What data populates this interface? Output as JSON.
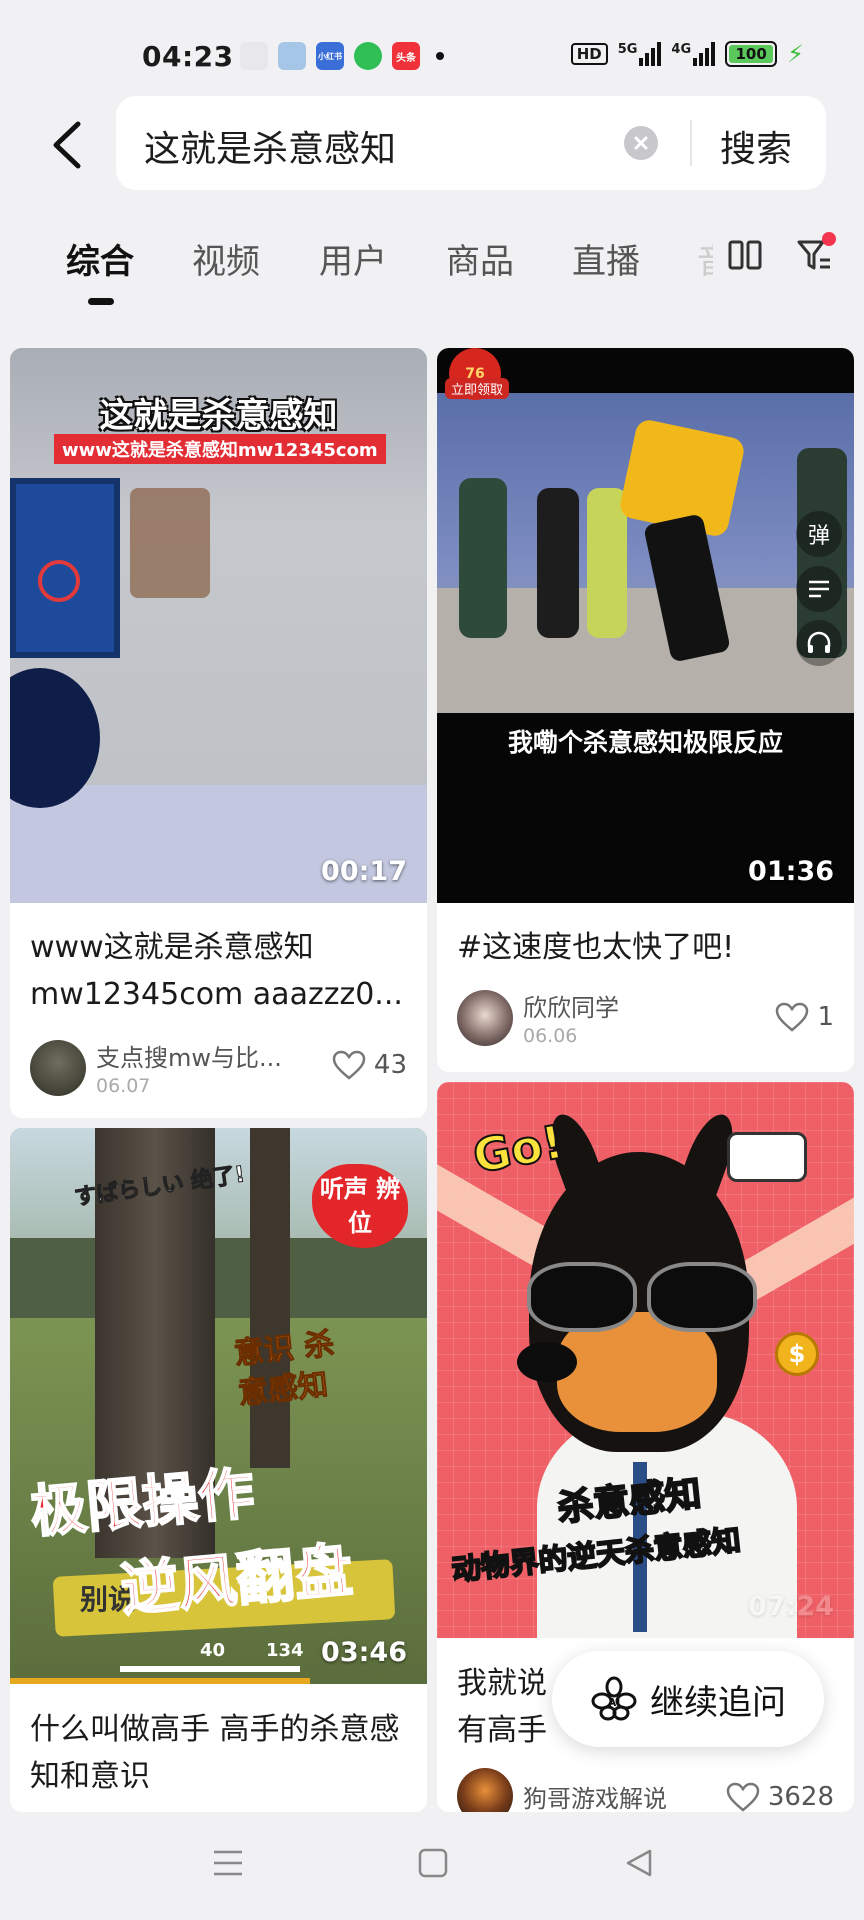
{
  "status_bar": {
    "time": "04:23",
    "app_icons": [
      {
        "name": "app-1-icon",
        "label": "",
        "color": "#e8e8ea"
      },
      {
        "name": "app-2-icon",
        "label": "",
        "color": "#a6c6e8"
      },
      {
        "name": "xiaohongshu-icon",
        "label": "小红书",
        "color": "#3a6fd8"
      },
      {
        "name": "app-4-icon",
        "label": "",
        "color": "#2fbf55"
      },
      {
        "name": "toutiao-icon",
        "label": "头条",
        "color": "#f0313a"
      }
    ],
    "hd_label": "HD",
    "net1": "5G",
    "net2": "4G",
    "battery": "100"
  },
  "search": {
    "query": "这就是杀意感知",
    "submit_label": "搜索"
  },
  "tabs": [
    {
      "label": "综合",
      "active": true
    },
    {
      "label": "视频",
      "active": false
    },
    {
      "label": "用户",
      "active": false
    },
    {
      "label": "商品",
      "active": false
    },
    {
      "label": "直播",
      "active": false
    },
    {
      "label": "音",
      "active": false
    }
  ],
  "cards": [
    {
      "duration": "00:17",
      "overlay_title": "这就是杀意感知",
      "overlay_sub": "www这就是杀意感知mw12345com",
      "title": "www这就是杀意感知 mw12345com aaazzz0...",
      "author": "支点搜mw与比...",
      "date": "06.07",
      "likes": "43"
    },
    {
      "duration": "01:36",
      "overlay_caption": "我嘞个杀意感知极限反应",
      "badge_top": "76",
      "badge_label": "立即领取",
      "side_icon_label": "弹",
      "title": "#这速度也太快了吧!",
      "author": "欣欣同学",
      "date": "06.06",
      "likes": "1"
    },
    {
      "duration": "03:46",
      "overlay_top": "すばらしい 绝了!",
      "overlay_red": "听声 辨位",
      "overlay_orange": "意识 杀意感知",
      "overlay_big1": "极限操作",
      "overlay_big2": "逆风翻盘",
      "overlay_yellow": "别说",
      "hud_number": "40",
      "hud_number2": "134",
      "title": "什么叫做高手 高手的杀意感知和意识"
    },
    {
      "duration": "07:24",
      "overlay_go": "Go!",
      "overlay_title": "杀意感知",
      "overlay_sub": "动物界的逆天杀意感知",
      "coin": "$",
      "title": "我就说 有高手",
      "author": "狗哥游戏解说",
      "likes": "3628"
    }
  ],
  "ai_button": {
    "label": "继续追问",
    "badge": "AI"
  },
  "colors": {
    "accent": "#f3364e",
    "background": "#f1f1f3"
  }
}
